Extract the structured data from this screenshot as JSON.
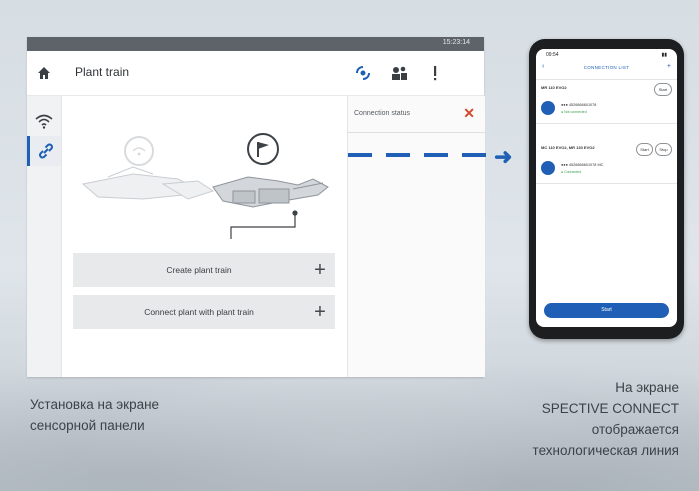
{
  "tablet": {
    "status_time": "15:23:14",
    "title": "Plant train",
    "home_icon": "home-icon",
    "toolbar_icons": [
      "connection-icon",
      "users-icon",
      "alert-icon"
    ],
    "rail_icons": [
      "wifi-icon",
      "link-icon"
    ],
    "connection_status_label": "Connection status",
    "connection_status_icon": "close-icon",
    "buttons": [
      {
        "label": "Create plant train",
        "icon": "plus-icon"
      },
      {
        "label": "Connect plant with plant train",
        "icon": "plus-icon"
      }
    ],
    "colors": {
      "accent": "#1f5fb5",
      "error": "#d24a2c"
    }
  },
  "phone": {
    "time": "09:54",
    "battery": "▮▮",
    "back": "‹",
    "title": "CONNECTION LIST",
    "add": "+",
    "section1": {
      "title": "MR 110 EVO2",
      "pill": "Start",
      "item_name": "●●● 4526866601078",
      "item_status": "● Not connected"
    },
    "section2": {
      "title": "MC 110 EVO2, MR 130 EVO2",
      "pills": [
        "Start",
        "Stop"
      ],
      "item_name": "●●● 4526866601078 MC",
      "item_status": "● Connected"
    },
    "start_button": "Start"
  },
  "captions": {
    "left": [
      "Установка на экране",
      "сенсорной панели"
    ],
    "right": [
      "На экране",
      "SPECTIVE CONNECT",
      "отображается",
      "технологическая линия"
    ]
  }
}
